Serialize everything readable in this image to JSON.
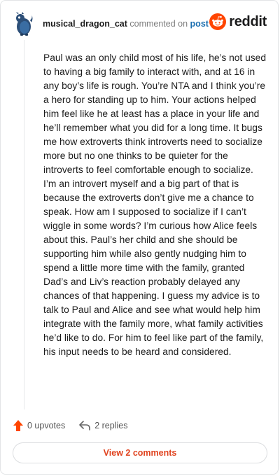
{
  "comment": {
    "username": "musical_dragon_cat",
    "commented_on": "commented on",
    "post_link": "post",
    "body": "Paul was an only child most of his life, he’s not used to having a big family to interact with, and at 16 in any boy’s life is rough. You’re NTA and I think you’re a hero for standing up to him. Your actions helped him feel like he at least has a place in your life and he’ll remember what you did for a long time. It bugs me how extroverts think introverts need to socialize more but no one thinks to be quieter for the introverts to feel comfortable enough to socialize. I’m an introvert myself and a big part of that is because the extroverts don’t give me a chance to speak. How am I supposed to socialize if I can’t wiggle in some words? I’m curious how Alice feels about this. Paul’s her child and she should be supporting him while also gently nudging him to spend a little more time with the family, granted Dad’s and Liv’s reaction probably delayed any chances of that happening. I guess my advice is to talk to Paul and Alice and see what would help him integrate with the family more, what family activities he’d like to do. For him to feel like part of the family, his input needs to be heard and considered."
  },
  "brand": {
    "name": "reddit",
    "icon": "reddit-snoo-icon",
    "color": "#ff4500"
  },
  "actions": {
    "upvotes_label": "0 upvotes",
    "replies_label": "2 replies",
    "upvote_icon": "upvote-arrow-icon",
    "reply_icon": "reply-arrow-icon",
    "upvote_color": "#ff4500"
  },
  "footer": {
    "view_comments_label": "View 2 comments",
    "accent": "#e0431f"
  }
}
